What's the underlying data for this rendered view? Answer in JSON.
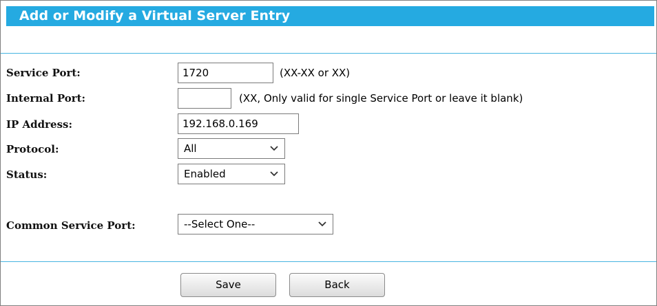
{
  "header": {
    "title": "Add or Modify a Virtual Server Entry"
  },
  "form": {
    "service_port": {
      "label": "Service Port:",
      "value": "1720",
      "hint": "(XX-XX or XX)"
    },
    "internal_port": {
      "label": "Internal Port:",
      "value": "",
      "hint": "(XX, Only valid for single Service Port or leave it blank)"
    },
    "ip_address": {
      "label": "IP Address:",
      "value": "192.168.0.169"
    },
    "protocol": {
      "label": "Protocol:",
      "value": "All"
    },
    "status": {
      "label": "Status:",
      "value": "Enabled"
    },
    "common_service_port": {
      "label": "Common Service Port:",
      "value": "--Select One--"
    }
  },
  "actions": {
    "save_label": "Save",
    "back_label": "Back"
  },
  "colors": {
    "title_bar": "#25aae1",
    "title_text": "#ffffff",
    "divider": "#45b4e0"
  },
  "icons": {
    "dropdown": "chevron-down-icon"
  }
}
